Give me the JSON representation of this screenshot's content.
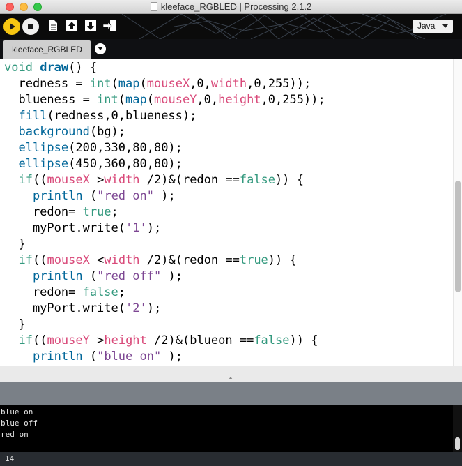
{
  "window": {
    "title": "kleeface_RGBLED | Processing 2.1.2"
  },
  "toolbar": {
    "mode": "Java",
    "buttons": [
      {
        "name": "run",
        "icon": "play-icon"
      },
      {
        "name": "stop",
        "icon": "stop-icon"
      },
      {
        "name": "new",
        "icon": "new-file-icon"
      },
      {
        "name": "open",
        "icon": "open-arrow-up-icon"
      },
      {
        "name": "save",
        "icon": "save-arrow-down-icon"
      },
      {
        "name": "export",
        "icon": "export-arrow-icon"
      }
    ],
    "accent_color": "#f6c612"
  },
  "tabs": [
    {
      "label": "kleeface_RGBLED",
      "active": true
    }
  ],
  "editor": {
    "lines": [
      [
        {
          "t": "void",
          "c": "kw"
        },
        {
          "t": " "
        },
        {
          "t": "draw",
          "c": "fnb"
        },
        {
          "t": "() {"
        }
      ],
      [
        {
          "t": "  redness = "
        },
        {
          "t": "int",
          "c": "kw"
        },
        {
          "t": "("
        },
        {
          "t": "map",
          "c": "fn"
        },
        {
          "t": "("
        },
        {
          "t": "mouseX",
          "c": "var"
        },
        {
          "t": ",0,"
        },
        {
          "t": "width",
          "c": "var"
        },
        {
          "t": ",0,255));"
        }
      ],
      [
        {
          "t": "  blueness = "
        },
        {
          "t": "int",
          "c": "kw"
        },
        {
          "t": "("
        },
        {
          "t": "map",
          "c": "fn"
        },
        {
          "t": "("
        },
        {
          "t": "mouseY",
          "c": "var"
        },
        {
          "t": ",0,"
        },
        {
          "t": "height",
          "c": "var"
        },
        {
          "t": ",0,255));"
        }
      ],
      [
        {
          "t": "  "
        },
        {
          "t": "fill",
          "c": "fn"
        },
        {
          "t": "(redness,0,blueness);"
        }
      ],
      [
        {
          "t": "  "
        },
        {
          "t": "background",
          "c": "fn"
        },
        {
          "t": "(bg);"
        }
      ],
      [
        {
          "t": "  "
        },
        {
          "t": "ellipse",
          "c": "fn"
        },
        {
          "t": "(200,330,80,80);"
        }
      ],
      [
        {
          "t": "  "
        },
        {
          "t": "ellipse",
          "c": "fn"
        },
        {
          "t": "(450,360,80,80);"
        }
      ],
      [
        {
          "t": "  "
        },
        {
          "t": "if",
          "c": "kw"
        },
        {
          "t": "(("
        },
        {
          "t": "mouseX",
          "c": "var"
        },
        {
          "t": " >"
        },
        {
          "t": "width",
          "c": "var"
        },
        {
          "t": " /2)&(redon =="
        },
        {
          "t": "false",
          "c": "kw"
        },
        {
          "t": ")) {"
        }
      ],
      [
        {
          "t": "    "
        },
        {
          "t": "println",
          "c": "fn"
        },
        {
          "t": " ("
        },
        {
          "t": "\"red on\"",
          "c": "str"
        },
        {
          "t": " );"
        }
      ],
      [
        {
          "t": "    redon= "
        },
        {
          "t": "true",
          "c": "kw"
        },
        {
          "t": ";"
        }
      ],
      [
        {
          "t": "    myPort.write("
        },
        {
          "t": "'1'",
          "c": "str"
        },
        {
          "t": ");"
        }
      ],
      [
        {
          "t": "  }"
        }
      ],
      [
        {
          "t": "  "
        },
        {
          "t": "if",
          "c": "kw"
        },
        {
          "t": "(("
        },
        {
          "t": "mouseX",
          "c": "var"
        },
        {
          "t": " <"
        },
        {
          "t": "width",
          "c": "var"
        },
        {
          "t": " /2)&(redon =="
        },
        {
          "t": "true",
          "c": "kw"
        },
        {
          "t": ")) {"
        }
      ],
      [
        {
          "t": "    "
        },
        {
          "t": "println",
          "c": "fn"
        },
        {
          "t": " ("
        },
        {
          "t": "\"red off\"",
          "c": "str"
        },
        {
          "t": " );"
        }
      ],
      [
        {
          "t": "    redon= "
        },
        {
          "t": "false",
          "c": "kw"
        },
        {
          "t": ";"
        }
      ],
      [
        {
          "t": "    myPort.write("
        },
        {
          "t": "'2'",
          "c": "str"
        },
        {
          "t": ");"
        }
      ],
      [
        {
          "t": "  }"
        }
      ],
      [
        {
          "t": "  "
        },
        {
          "t": "if",
          "c": "kw"
        },
        {
          "t": "(("
        },
        {
          "t": "mouseY",
          "c": "var"
        },
        {
          "t": " >"
        },
        {
          "t": "height",
          "c": "var"
        },
        {
          "t": " /2)&(blueon =="
        },
        {
          "t": "false",
          "c": "kw"
        },
        {
          "t": ")) {"
        }
      ],
      [
        {
          "t": "    "
        },
        {
          "t": "println",
          "c": "fn"
        },
        {
          "t": " ("
        },
        {
          "t": "\"blue on\"",
          "c": "str"
        },
        {
          "t": " );"
        }
      ]
    ],
    "colors": {
      "keyword": "#33997e",
      "function": "#006699",
      "builtin_var": "#d94a7a",
      "string": "#7d4793"
    }
  },
  "console": {
    "lines": [
      "blue on",
      "blue off",
      "red on"
    ]
  },
  "footer": {
    "line_number": "14"
  }
}
